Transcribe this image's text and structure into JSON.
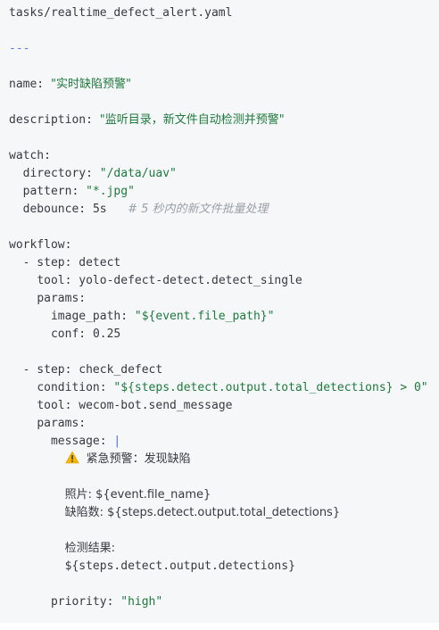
{
  "file": {
    "path": "tasks/realtime_defect_alert.yaml",
    "separator": "---"
  },
  "yaml": {
    "name_key": "name:",
    "name_value": "\"实时缺陷预警\"",
    "description_key": "description:",
    "description_value": "\"监听目录，新文件自动检测并预警\"",
    "watch_key": "watch:",
    "directory_key": "directory:",
    "directory_value": "\"/data/uav\"",
    "pattern_key": "pattern:",
    "pattern_value": "\"*.jpg\"",
    "debounce_key": "debounce:",
    "debounce_value": "5s",
    "debounce_comment": "# 5 秒内的新文件批量处理",
    "workflow_key": "workflow:",
    "step1_key": "- step:",
    "step1_value": "detect",
    "tool1_key": "tool:",
    "tool1_value": "yolo-defect-detect.detect_single",
    "params1_key": "params:",
    "image_path_key": "image_path:",
    "image_path_value": "\"${event.file_path}\"",
    "conf_key": "conf:",
    "conf_value": "0.25",
    "step2_key": "- step:",
    "step2_value": "check_defect",
    "condition_key": "condition:",
    "condition_value": "\"${steps.detect.output.total_detections} > 0\"",
    "tool2_key": "tool:",
    "tool2_value": "wecom-bot.send_message",
    "params2_key": "params:",
    "message_key": "message:",
    "message_pipe": "|",
    "msg_alert": "紧急预警：发现缺陷",
    "msg_photo": "照片: ${event.file_name}",
    "msg_count": "缺陷数: ${steps.detect.output.total_detections}",
    "msg_result_label": "检测结果:",
    "msg_result_value": "${steps.detect.output.detections}",
    "priority_key": "priority:",
    "priority_value": "\"high\""
  },
  "colors": {
    "background": "#f6f7f9",
    "key_text": "#383a42",
    "string_text": "#1f7a3e",
    "comment_text": "#9aa0a6",
    "separator": "#5a7fd6",
    "warning_icon": "#f4b400"
  },
  "icons": {
    "alert": "warning-icon"
  }
}
